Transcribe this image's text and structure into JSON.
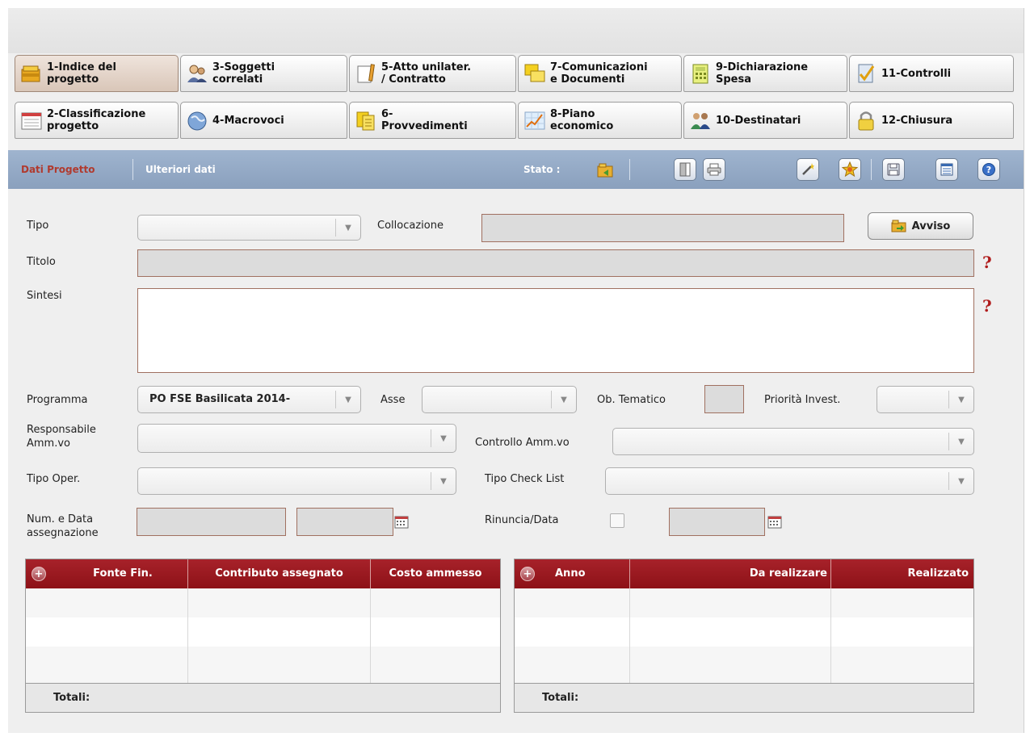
{
  "tabs": [
    {
      "id": "t1",
      "label": "1-Indice del\nprogetto",
      "icon": "folder-icon",
      "active": true
    },
    {
      "id": "t3",
      "label": "3-Soggetti\ncorrelati",
      "icon": "users-icon"
    },
    {
      "id": "t5",
      "label": "5-Atto unilater.\n/ Contratto",
      "icon": "document-pencil-icon"
    },
    {
      "id": "t7",
      "label": "7-Comunicazioni\ne Documenti",
      "icon": "messages-icon"
    },
    {
      "id": "t9",
      "label": "9-Dichiarazione\nSpesa",
      "icon": "calculator-icon"
    },
    {
      "id": "t11",
      "label": "11-Controlli",
      "icon": "checklist-icon"
    },
    {
      "id": "t2",
      "label": "2-Classificazione\nprogetto",
      "icon": "window-list-icon"
    },
    {
      "id": "t4",
      "label": "4-Macrovoci",
      "icon": "globe-icon"
    },
    {
      "id": "t6",
      "label": "6-\nProvvedimenti",
      "icon": "notes-icon"
    },
    {
      "id": "t8",
      "label": "8-Piano\neconomico",
      "icon": "chart-icon"
    },
    {
      "id": "t10",
      "label": "10-Destinatari",
      "icon": "people-icon"
    },
    {
      "id": "t12",
      "label": "12-Chiusura",
      "icon": "lock-icon"
    }
  ],
  "toolbar": {
    "link_active": "Dati Progetto",
    "link_other": "Ulteriori dati",
    "stato_label": "Stato :"
  },
  "form": {
    "tipo_label": "Tipo",
    "collocazione_label": "Collocazione",
    "avviso_label": "Avviso",
    "titolo_label": "Titolo",
    "sintesi_label": "Sintesi",
    "help_mark": "?",
    "programma_label": "Programma",
    "programma_value": "PO FSE Basilicata 2014-",
    "asse_label": "Asse",
    "ob_tematico_label": "Ob. Tematico",
    "priorita_label": "Priorità Invest.",
    "responsabile_label_1": "Responsabile",
    "responsabile_label_2": "Amm.vo",
    "controllo_label": "Controllo Amm.vo",
    "tipo_oper_label": "Tipo Oper.",
    "tipo_checklist_label": "Tipo Check List",
    "num_data_label_1": "Num. e Data",
    "num_data_label_2": "assegnazione",
    "rinuncia_label": "Rinuncia/Data",
    "combo_arrow": "▼"
  },
  "grid_left": {
    "columns": [
      "Fonte Fin.",
      "Contributo assegnato",
      "Costo ammesso"
    ],
    "totals_label": "Totali:"
  },
  "grid_right": {
    "columns": [
      "Anno",
      "Da realizzare",
      "Realizzato"
    ],
    "totals_label": "Totali:"
  },
  "colors": {
    "toolbar_bg": "#8fa5c2",
    "active_link": "#b03a2e",
    "grid_header": "#9a1a20",
    "field_border": "#a07060"
  }
}
